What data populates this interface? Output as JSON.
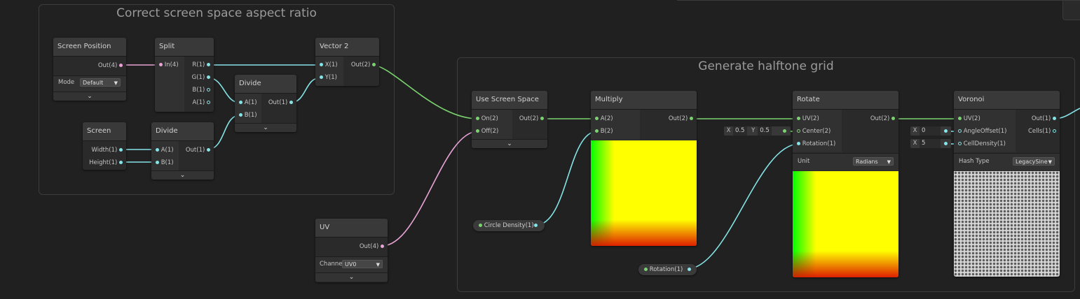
{
  "groups": {
    "aspect": {
      "title": "Correct screen space aspect ratio"
    },
    "halftone": {
      "title": "Generate halftone grid"
    }
  },
  "nodes": {
    "screen_position": {
      "title": "Screen Position",
      "out": "Out(4)",
      "mode_label": "Mode",
      "mode_value": "Default"
    },
    "split": {
      "title": "Split",
      "in": "In(4)",
      "r": "R(1)",
      "g": "G(1)",
      "b": "B(1)",
      "a": "A(1)"
    },
    "vector2": {
      "title": "Vector 2",
      "x": "X(1)",
      "y": "Y(1)",
      "out": "Out(2)"
    },
    "divide1": {
      "title": "Divide",
      "a": "A(1)",
      "b": "B(1)",
      "out": "Out(1)"
    },
    "screen": {
      "title": "Screen",
      "width": "Width(1)",
      "height": "Height(1)"
    },
    "divide2": {
      "title": "Divide",
      "a": "A(1)",
      "b": "B(1)",
      "out": "Out(1)"
    },
    "uv": {
      "title": "UV",
      "out": "Out(4)",
      "channel_label": "Channe",
      "channel_value": "UV0"
    },
    "use_screen_space": {
      "title": "Use Screen Space",
      "on": "On(2)",
      "off": "Off(2)",
      "out": "Out(2)"
    },
    "multiply": {
      "title": "Multiply",
      "a": "A(2)",
      "b": "B(2)",
      "out": "Out(2)"
    },
    "rotate": {
      "title": "Rotate",
      "uv": "UV(2)",
      "center": "Center(2)",
      "rotation": "Rotation(1)",
      "out": "Out(2)",
      "unit_label": "Unit",
      "unit_value": "Radians"
    },
    "voronoi": {
      "title": "Voronoi",
      "uv": "UV(2)",
      "angle": "AngleOffset(1)",
      "density": "CellDensity(1)",
      "out": "Out(1)",
      "cells": "Cells(1)",
      "hash_label": "Hash Type",
      "hash_value": "LegacySine"
    }
  },
  "properties": {
    "circle_density": "Circle Density(1)",
    "rotation": "Rotation(1)"
  },
  "inline_values": {
    "center_x_label": "X",
    "center_x": "0.5",
    "center_y_label": "Y",
    "center_y": "0.5",
    "angle_x_label": "X",
    "angle_x": "0",
    "density_x_label": "X",
    "density_x": "5"
  },
  "icons": {
    "collapse": "chevron-down-icon",
    "dropdown": "triangle-down-icon"
  },
  "colors": {
    "background": "#202020",
    "wire_vector1": "#84e4e7",
    "wire_vector2": "#7ad36f",
    "wire_vector4": "#e9a3d6"
  }
}
